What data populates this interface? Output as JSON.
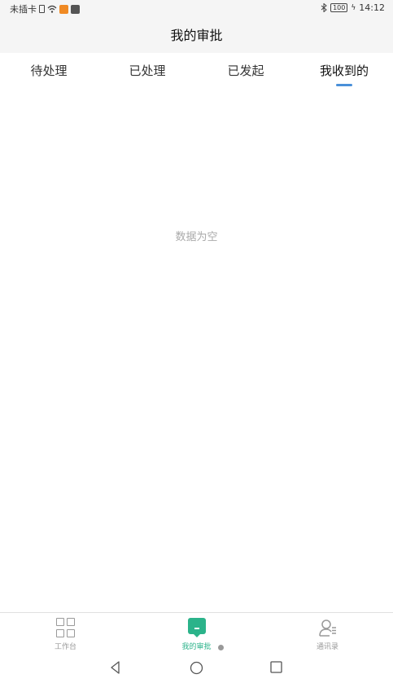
{
  "status_bar": {
    "carrier": "未插卡",
    "battery": "100",
    "time": "14:12"
  },
  "header": {
    "title": "我的审批"
  },
  "tabs": [
    {
      "label": "待处理",
      "active": false
    },
    {
      "label": "已处理",
      "active": false
    },
    {
      "label": "已发起",
      "active": false
    },
    {
      "label": "我收到的",
      "active": true
    }
  ],
  "empty_state": {
    "text": "数据为空"
  },
  "bottom_nav": [
    {
      "label": "工作台",
      "icon": "grid-icon",
      "active": false
    },
    {
      "label": "我的审批",
      "icon": "approval-icon",
      "active": true
    },
    {
      "label": "通讯录",
      "icon": "contacts-icon",
      "active": false
    }
  ],
  "colors": {
    "accent": "#2bb38a",
    "tab_indicator": "#4a90d9"
  }
}
